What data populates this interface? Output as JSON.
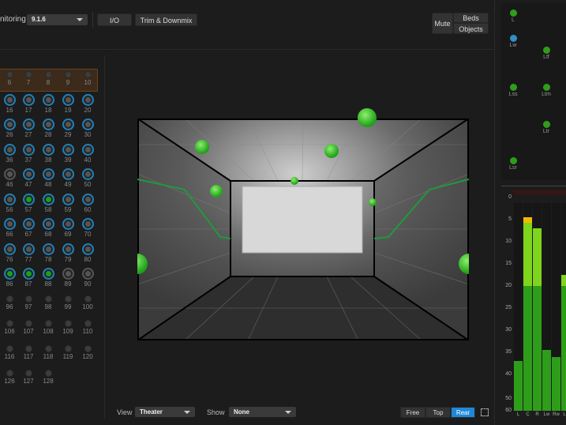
{
  "toolbar": {
    "monitoring_label": "nitoring",
    "monitoring_value": "9.1.6",
    "io_button": "I/O",
    "trim_button": "Trim & Downmix",
    "mute_button": "Mute",
    "beds_button": "Beds",
    "objects_button": "Objects"
  },
  "objects": [
    {
      "n": "6",
      "s": "off"
    },
    {
      "n": "7",
      "s": "off"
    },
    {
      "n": "8",
      "s": "off"
    },
    {
      "n": "9",
      "s": "off"
    },
    {
      "n": "10",
      "s": "off"
    },
    {
      "n": "16",
      "s": "blue"
    },
    {
      "n": "17",
      "s": "blue"
    },
    {
      "n": "18",
      "s": "blue"
    },
    {
      "n": "19",
      "s": "blue"
    },
    {
      "n": "20",
      "s": "blue"
    },
    {
      "n": "26",
      "s": "blue"
    },
    {
      "n": "27",
      "s": "blue"
    },
    {
      "n": "28",
      "s": "blue"
    },
    {
      "n": "29",
      "s": "blue"
    },
    {
      "n": "30",
      "s": "blue"
    },
    {
      "n": "36",
      "s": "blue"
    },
    {
      "n": "37",
      "s": "blue"
    },
    {
      "n": "38",
      "s": "blue"
    },
    {
      "n": "39",
      "s": "blue"
    },
    {
      "n": "40",
      "s": "blue"
    },
    {
      "n": "46",
      "s": "gray"
    },
    {
      "n": "47",
      "s": "blue"
    },
    {
      "n": "48",
      "s": "blue"
    },
    {
      "n": "49",
      "s": "blue"
    },
    {
      "n": "50",
      "s": "blue"
    },
    {
      "n": "56",
      "s": "blue"
    },
    {
      "n": "57",
      "s": "green"
    },
    {
      "n": "58",
      "s": "green"
    },
    {
      "n": "59",
      "s": "blue"
    },
    {
      "n": "60",
      "s": "blue"
    },
    {
      "n": "66",
      "s": "blue"
    },
    {
      "n": "67",
      "s": "blue"
    },
    {
      "n": "68",
      "s": "blue"
    },
    {
      "n": "69",
      "s": "blue"
    },
    {
      "n": "70",
      "s": "blue"
    },
    {
      "n": "76",
      "s": "blue"
    },
    {
      "n": "77",
      "s": "blue"
    },
    {
      "n": "78",
      "s": "blue"
    },
    {
      "n": "79",
      "s": "blue"
    },
    {
      "n": "80",
      "s": "blue"
    },
    {
      "n": "86",
      "s": "green"
    },
    {
      "n": "87",
      "s": "green"
    },
    {
      "n": "88",
      "s": "green"
    },
    {
      "n": "89",
      "s": "gray"
    },
    {
      "n": "90",
      "s": "gray"
    },
    {
      "n": "96",
      "s": "off"
    },
    {
      "n": "97",
      "s": "off"
    },
    {
      "n": "98",
      "s": "off"
    },
    {
      "n": "99",
      "s": "off"
    },
    {
      "n": "100",
      "s": "off"
    },
    {
      "n": "106",
      "s": "off"
    },
    {
      "n": "107",
      "s": "off"
    },
    {
      "n": "108",
      "s": "off"
    },
    {
      "n": "109",
      "s": "off"
    },
    {
      "n": "110",
      "s": "off"
    },
    {
      "n": "116",
      "s": "off"
    },
    {
      "n": "117",
      "s": "off"
    },
    {
      "n": "118",
      "s": "off"
    },
    {
      "n": "119",
      "s": "off"
    },
    {
      "n": "120",
      "s": "off"
    },
    {
      "n": "126",
      "s": "off"
    },
    {
      "n": "127",
      "s": "off"
    },
    {
      "n": "128",
      "s": "off"
    }
  ],
  "speakers": [
    {
      "l": "L",
      "c": "#2e9e1a"
    },
    {
      "l": "Lw",
      "c": "#2f8fc8"
    },
    {
      "l": "Ltf",
      "c": "#2e9e1a"
    },
    {
      "l": "Lss",
      "c": "#2e9e1a"
    },
    {
      "l": "Ltm",
      "c": "#2e9e1a"
    },
    {
      "l": "Ltr",
      "c": "#2e9e1a"
    },
    {
      "l": "Lsr",
      "c": "#2e9e1a"
    }
  ],
  "meter": {
    "scale": [
      "0",
      "5",
      "10",
      "15",
      "20",
      "25",
      "30",
      "35",
      "40",
      "50",
      "60"
    ],
    "channels": [
      {
        "name": "L",
        "level": 37
      },
      {
        "name": "C",
        "level": 5,
        "peak": true
      },
      {
        "name": "R",
        "level": 7
      },
      {
        "name": "Lw",
        "level": 34.5
      },
      {
        "name": "Rw",
        "level": 36
      },
      {
        "name": "Ls",
        "level": 17.5
      }
    ]
  },
  "bottom": {
    "view_label": "View",
    "view_value": "Theater",
    "show_label": "Show",
    "show_value": "None",
    "free": "Free",
    "top": "Top",
    "rear": "Rear",
    "active": "Rear"
  },
  "colors": {
    "accent": "#1e88d8",
    "green": "#2e9e1a",
    "light_green": "#7fd41c",
    "peak": "#f5b800"
  }
}
